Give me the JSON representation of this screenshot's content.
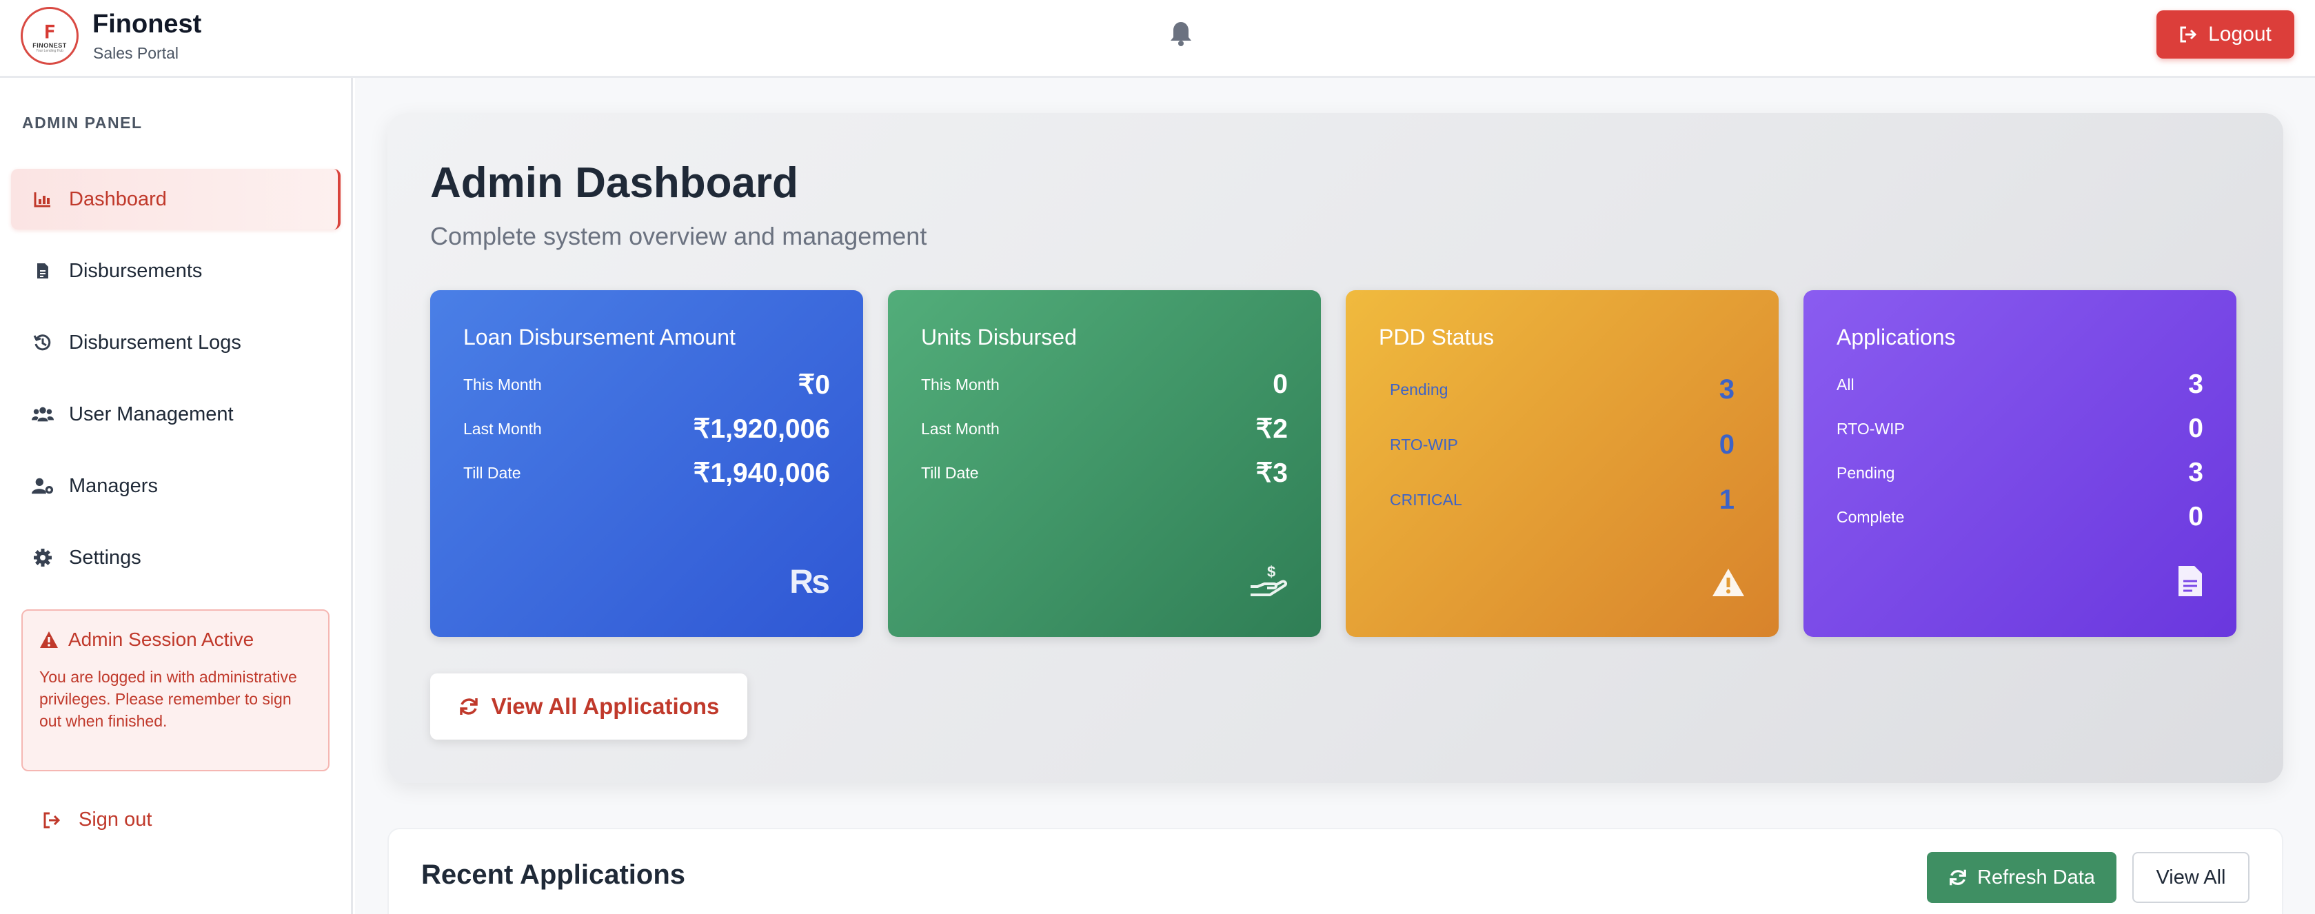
{
  "header": {
    "logo_text": "FINONEST",
    "logo_tagline": "Your Lending Hub",
    "app_name": "Finonest",
    "app_subtitle": "Sales Portal",
    "logout_label": "Logout"
  },
  "sidebar": {
    "panel_title": "ADMIN PANEL",
    "items": [
      {
        "label": "Dashboard",
        "icon": "chart-bar-icon",
        "active": true
      },
      {
        "label": "Disbursements",
        "icon": "file-icon"
      },
      {
        "label": "Disbursement Logs",
        "icon": "history-icon"
      },
      {
        "label": "User Management",
        "icon": "users-icon"
      },
      {
        "label": "Managers",
        "icon": "user-cog-icon"
      },
      {
        "label": "Settings",
        "icon": "gear-icon"
      }
    ],
    "alert": {
      "title": "Admin Session Active",
      "text": "You are logged in with administrative privileges. Please remember to sign out when finished."
    },
    "signout_label": "Sign out"
  },
  "main": {
    "title": "Admin Dashboard",
    "subtitle": "Complete system overview and management",
    "cards": [
      {
        "title": "Loan Disbursement Amount",
        "rows": [
          {
            "label": "This Month",
            "value": "₹0"
          },
          {
            "label": "Last Month",
            "value": "₹1,920,006"
          },
          {
            "label": "Till Date",
            "value": "₹1,940,006"
          }
        ],
        "icon": "rupee-icon",
        "icon_text": "₨"
      },
      {
        "title": "Units Disbursed",
        "rows": [
          {
            "label": "This Month",
            "value": "0"
          },
          {
            "label": "Last Month",
            "value": "₹2"
          },
          {
            "label": "Till Date",
            "value": "₹3"
          }
        ],
        "icon": "hand-holding-dollar-icon"
      },
      {
        "title": "PDD Status",
        "rows": [
          {
            "label": "Pending",
            "value": "3"
          },
          {
            "label": "RTO-WIP",
            "value": "0"
          },
          {
            "label": "CRITICAL",
            "value": "1"
          }
        ],
        "icon": "warning-icon"
      },
      {
        "title": "Applications",
        "rows": [
          {
            "label": "All",
            "value": "3"
          },
          {
            "label": "RTO-WIP",
            "value": "0"
          },
          {
            "label": "Pending",
            "value": "3"
          },
          {
            "label": "Complete",
            "value": "0"
          }
        ],
        "icon": "document-icon"
      }
    ],
    "view_all_applications_label": "View All Applications",
    "recent": {
      "title": "Recent Applications",
      "refresh_label": "Refresh Data",
      "view_all_label": "View All"
    }
  },
  "colors": {
    "accent_red": "#dc3e3a",
    "card_blue": "#3b6ee0",
    "card_green": "#3f9467",
    "card_orange": "#e59e35",
    "card_purple": "#7a48e7",
    "refresh_green": "#3f8f63"
  }
}
